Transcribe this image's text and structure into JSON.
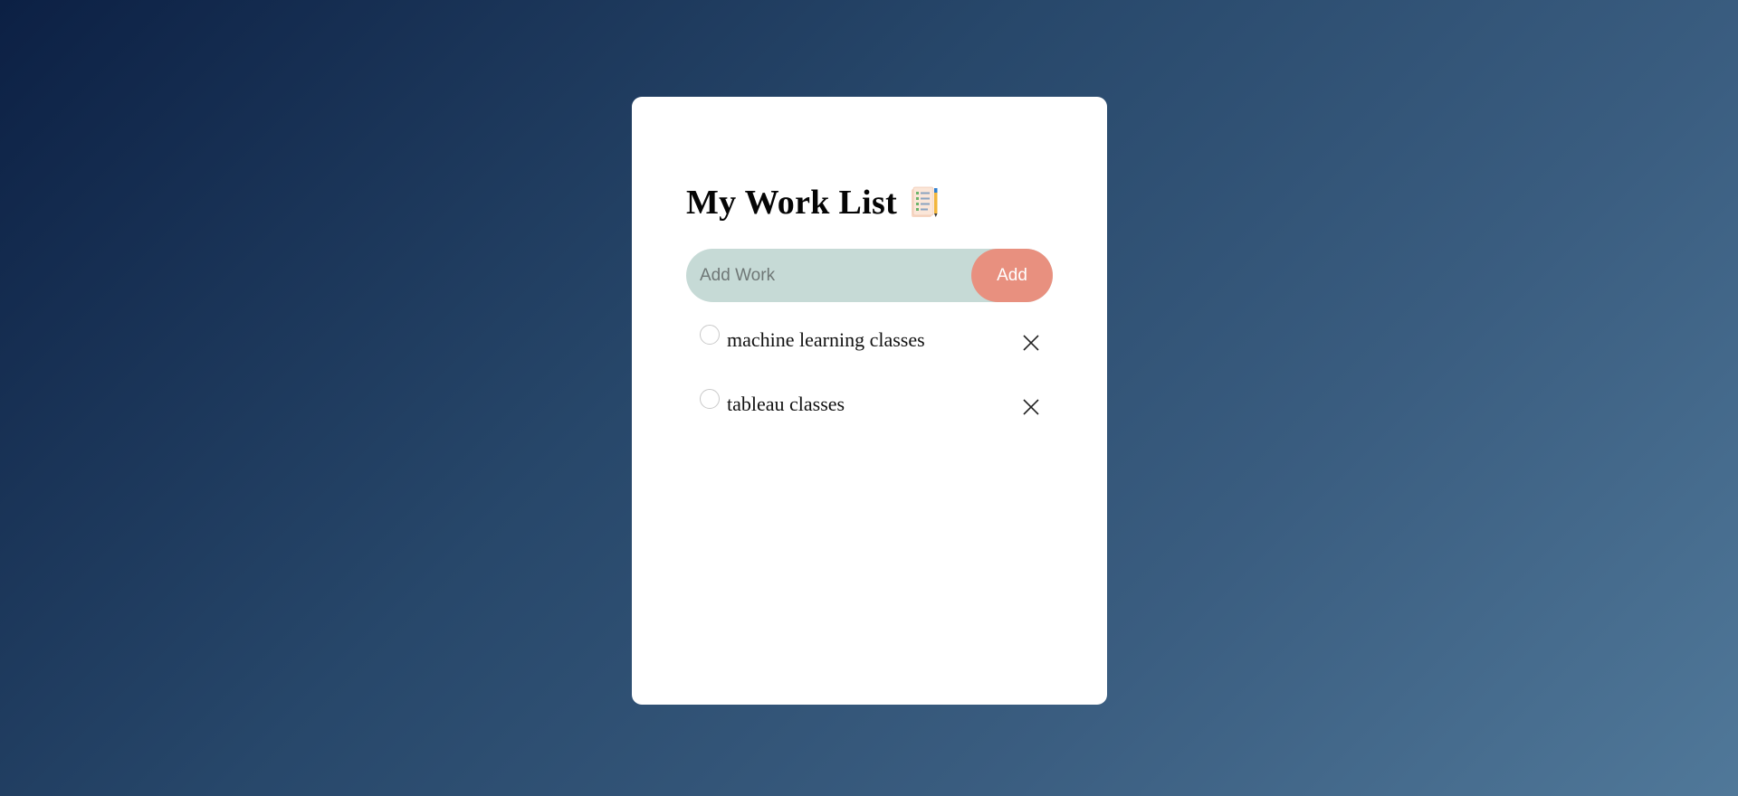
{
  "header": {
    "title": "My Work List"
  },
  "input": {
    "placeholder": "Add Work",
    "value": ""
  },
  "add_button": {
    "label": "Add"
  },
  "tasks": [
    {
      "text": "machine learning classes",
      "checked": false
    },
    {
      "text": "tableau classes",
      "checked": false
    }
  ],
  "icons": {
    "title_icon": "clipboard-list-icon",
    "remove": "close-icon",
    "check": "circle-check-icon"
  },
  "colors": {
    "input_bg": "#c6dad6",
    "button_bg": "#e8907f",
    "card_bg": "#ffffff",
    "bg_start": "#0c2044",
    "bg_end": "#507899"
  }
}
